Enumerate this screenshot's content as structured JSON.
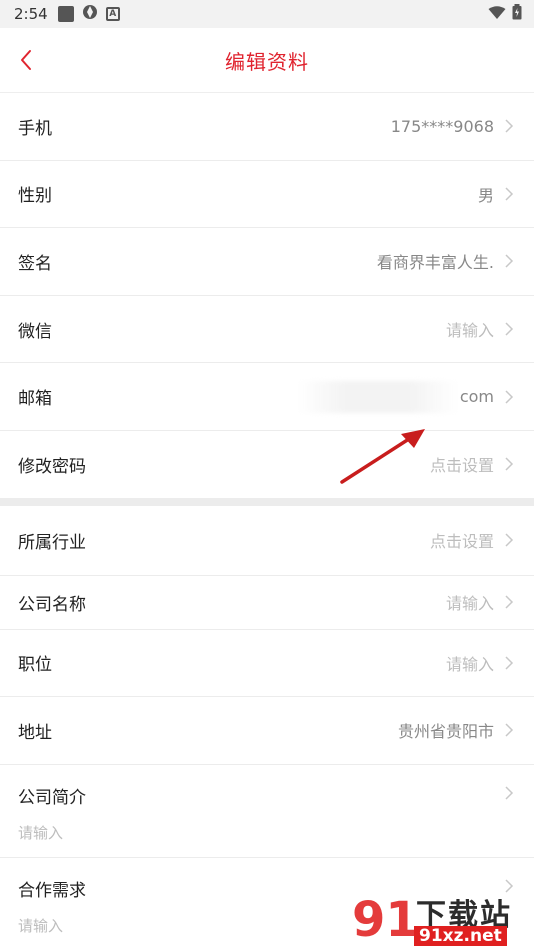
{
  "status_bar": {
    "time": "2:54",
    "badge": "A"
  },
  "nav": {
    "title": "编辑资料"
  },
  "profile_rows": [
    {
      "label": "手机",
      "value": "175****9068",
      "placeholder": false
    },
    {
      "label": "性别",
      "value": "男",
      "placeholder": false
    },
    {
      "label": "签名",
      "value": "看商界丰富人生.",
      "placeholder": false
    },
    {
      "label": "微信",
      "value": "请输入",
      "placeholder": true
    },
    {
      "label": "邮箱",
      "value": "com",
      "placeholder": false
    },
    {
      "label": "修改密码",
      "value": "点击设置",
      "placeholder": true
    }
  ],
  "company_rows": [
    {
      "label": "所属行业",
      "value": "点击设置",
      "placeholder": true
    },
    {
      "label": "公司名称",
      "value": "请输入",
      "placeholder": true
    },
    {
      "label": "职位",
      "value": "请输入",
      "placeholder": true
    },
    {
      "label": "地址",
      "value": "贵州省贵阳市",
      "placeholder": false
    }
  ],
  "tall_rows": [
    {
      "label": "公司简介",
      "placeholder": "请输入"
    },
    {
      "label": "合作需求",
      "placeholder": "请输入"
    }
  ],
  "watermark": {
    "text": "下载站",
    "site": "91xz.net"
  },
  "colors": {
    "accent": "#e0242f",
    "placeholder": "#bdbdbd",
    "value": "#888888"
  }
}
